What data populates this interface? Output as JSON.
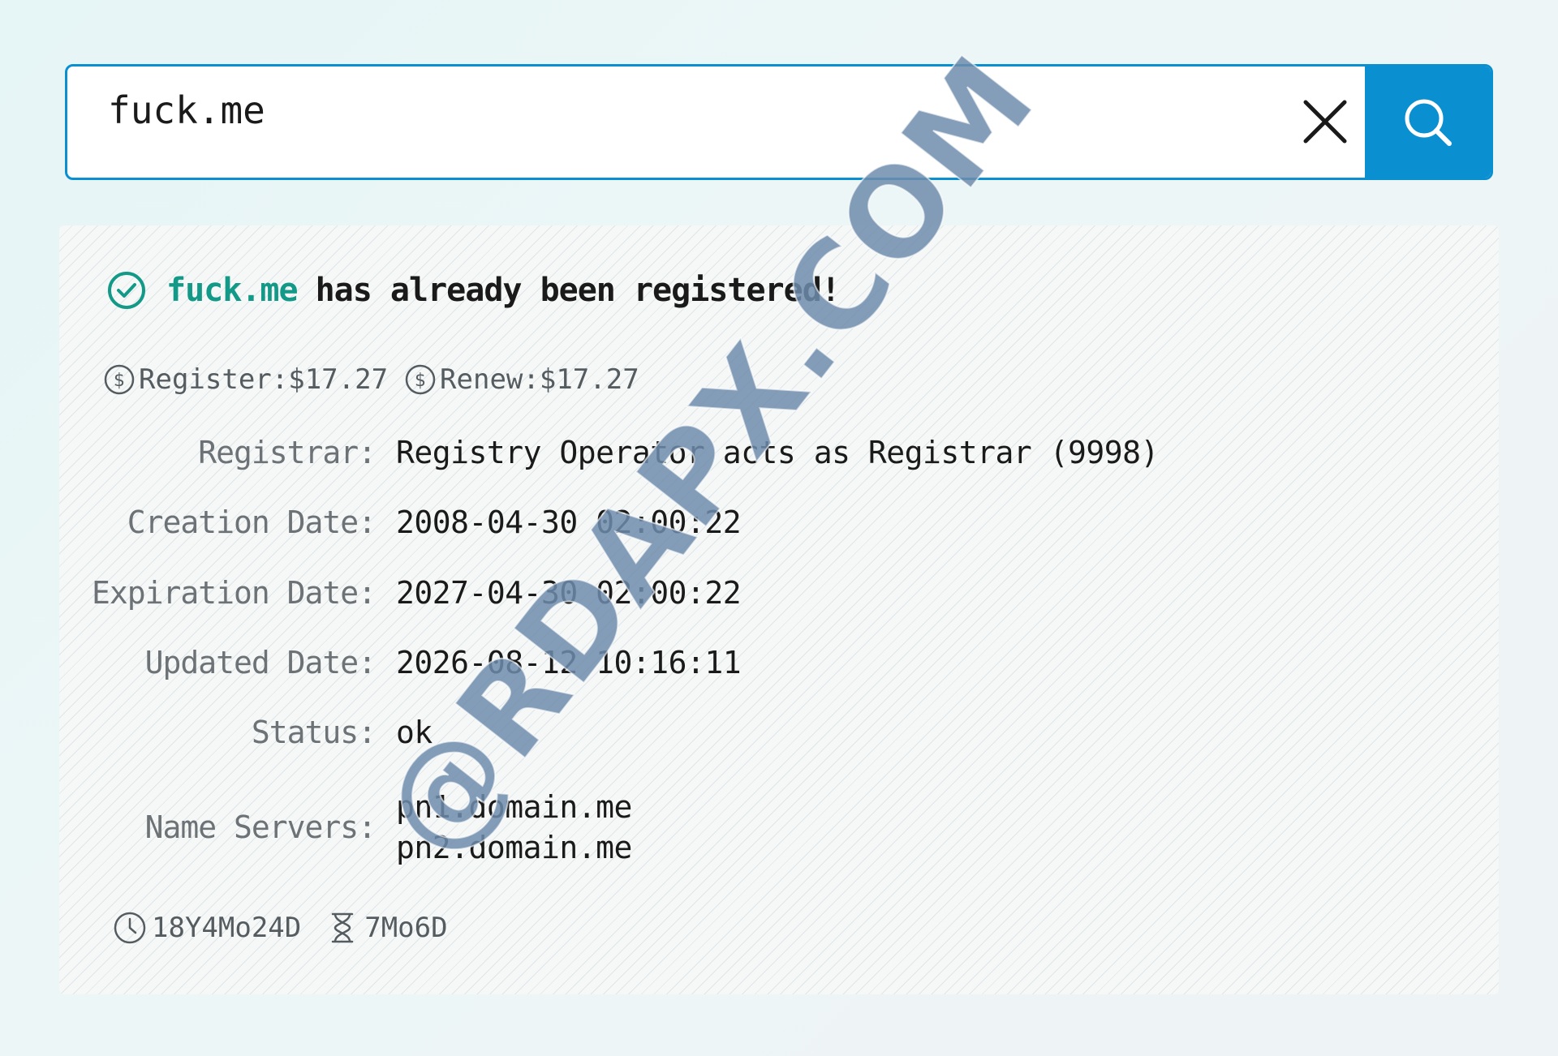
{
  "search": {
    "value": "fuck.me"
  },
  "icons": {
    "clear": "close-icon",
    "search": "search-icon",
    "check": "check-circle-icon",
    "price": "dollar-circle-icon",
    "age": "clock-icon",
    "remaining": "hourglass-icon"
  },
  "colors": {
    "accent": "#0a8fd0",
    "domain_highlight": "#139987",
    "watermark": "#6e8cab"
  },
  "result": {
    "domain": "fuck.me",
    "message": "has already been registered!"
  },
  "prices": {
    "register": "Register:$17.27",
    "renew": "Renew:$17.27"
  },
  "details": {
    "registrar_label": "Registrar:",
    "registrar_value": "Registry Operator acts as Registrar (9998)",
    "creation_label": "Creation Date:",
    "creation_value": "2008-04-30 02:00:22",
    "expiration_label": "Expiration Date:",
    "expiration_value": "2027-04-30 02:00:22",
    "updated_label": "Updated Date:",
    "updated_value": "2026-08-12 10:16:11",
    "status_label": "Status:",
    "status_value": "ok",
    "ns_label": "Name Servers:",
    "name_servers": [
      "pn1.domain.me",
      "pn2.domain.me"
    ]
  },
  "stats": {
    "age": "18Y4Mo24D",
    "remaining": "7Mo6D"
  },
  "watermark": {
    "text": "@RDAPX.COM"
  }
}
